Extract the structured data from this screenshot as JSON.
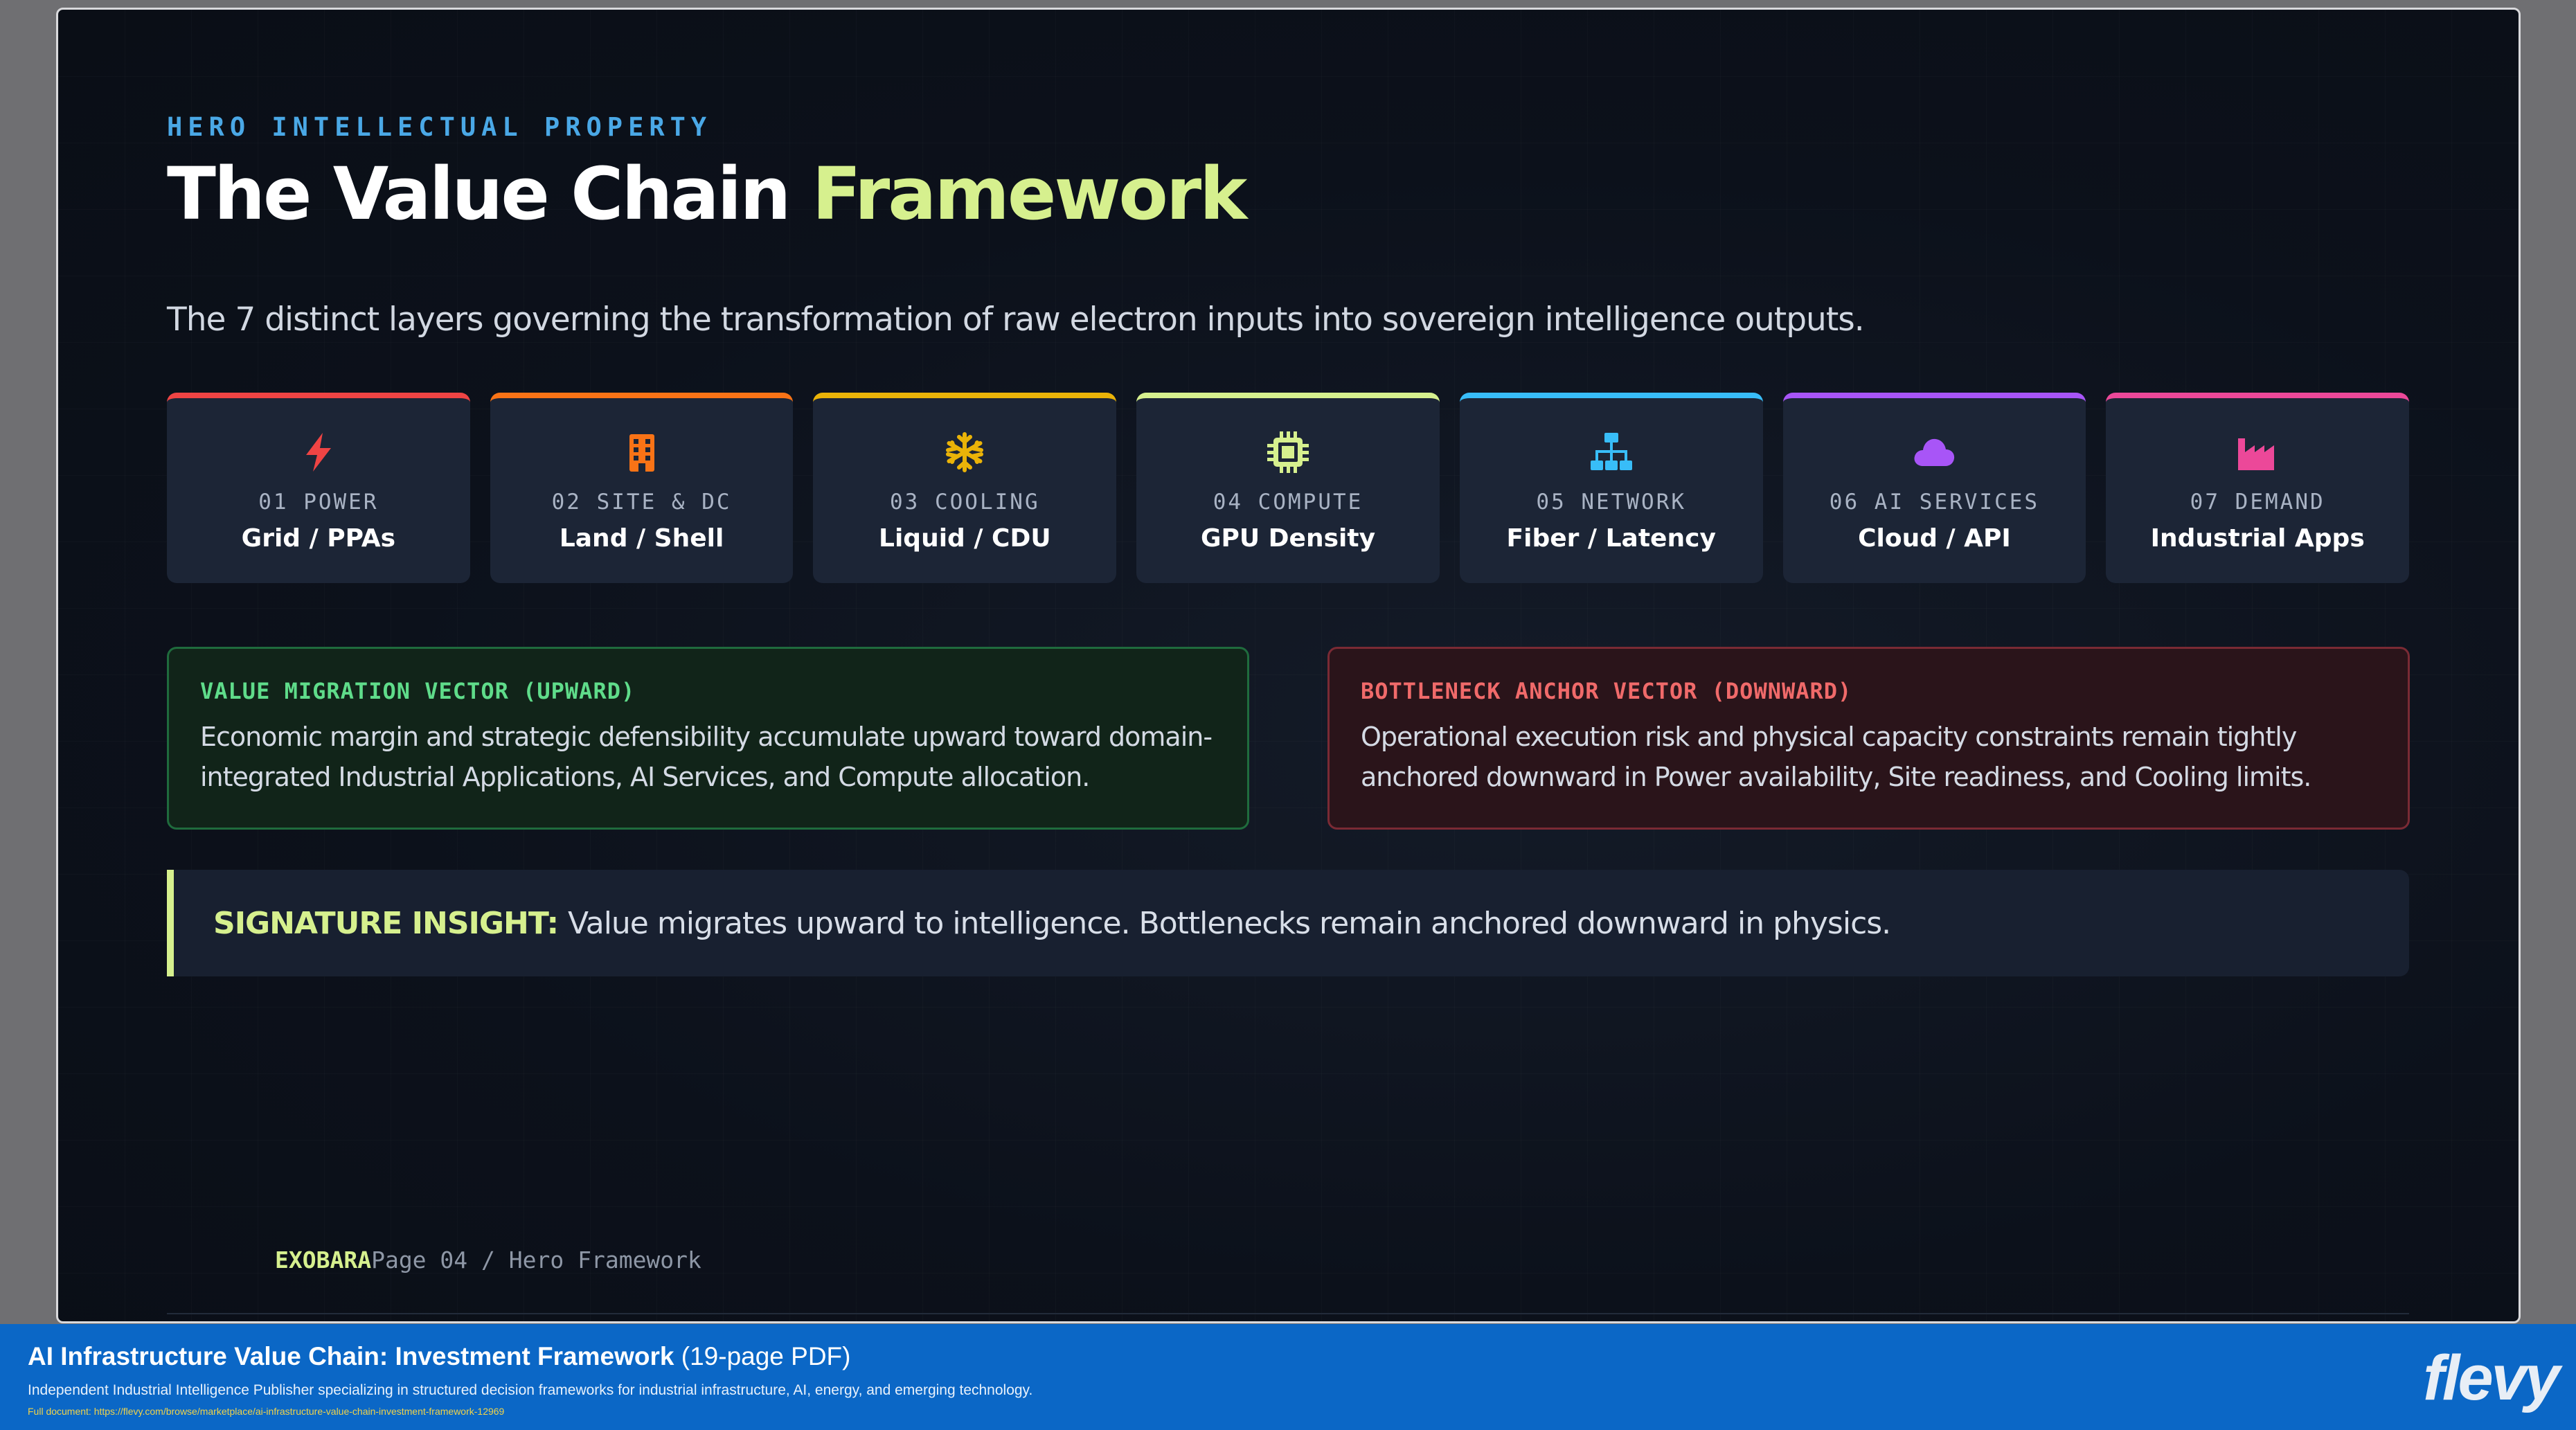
{
  "slide": {
    "eyebrow": "HERO INTELLECTUAL PROPERTY",
    "title_main": "The Value Chain",
    "title_accent": "Framework",
    "subtitle": "The 7 distinct layers governing the transformation of raw electron inputs into sovereign intelligence outputs.",
    "accent_color": "#d6f08e",
    "layers": [
      {
        "num": "01 POWER",
        "name": "Grid / PPAs",
        "icon": "lightning-bolt-icon",
        "color": "#ef4444"
      },
      {
        "num": "02 SITE & DC",
        "name": "Land / Shell",
        "icon": "building-icon",
        "color": "#f97316"
      },
      {
        "num": "03 COOLING",
        "name": "Liquid / CDU",
        "icon": "snowflake-icon",
        "color": "#eab308"
      },
      {
        "num": "04 COMPUTE",
        "name": "GPU Density",
        "icon": "microchip-icon",
        "color": "#d6f08e"
      },
      {
        "num": "05 NETWORK",
        "name": "Fiber / Latency",
        "icon": "network-icon",
        "color": "#38bdf8"
      },
      {
        "num": "06 AI SERVICES",
        "name": "Cloud / API",
        "icon": "cloud-icon",
        "color": "#a855f7"
      },
      {
        "num": "07 DEMAND",
        "name": "Industrial Apps",
        "icon": "industry-icon",
        "color": "#ec4899"
      }
    ],
    "value_vector": {
      "title": "VALUE MIGRATION VECTOR (UPWARD)",
      "body": "Economic margin and strategic defensibility accumulate upward toward domain-integrated Industrial Applications, AI Services, and Compute allocation."
    },
    "bottleneck_vector": {
      "title": "BOTTLENECK ANCHOR VECTOR (DOWNWARD)",
      "body": "Operational execution risk and physical capacity constraints remain tightly anchored downward in Power availability, Site readiness, and Cooling limits."
    },
    "insight": {
      "label": "SIGNATURE INSIGHT:",
      "text": "Value migrates upward to intelligence. Bottlenecks remain anchored downward in physics."
    },
    "footer": {
      "brand": "EXOBARA",
      "page": "Page 04 / Hero Framework"
    }
  },
  "banner": {
    "title_bold": "AI Infrastructure Value Chain: Investment Framework",
    "title_suffix": "(19-page PDF)",
    "description": "Independent Industrial Intelligence Publisher specializing in structured decision frameworks for industrial infrastructure, AI, energy, and emerging technology.",
    "link": "Full document: https://flevy.com/browse/marketplace/ai-infrastructure-value-chain-investment-framework-12969",
    "logo": "flevy",
    "color": "#0b67c6"
  }
}
